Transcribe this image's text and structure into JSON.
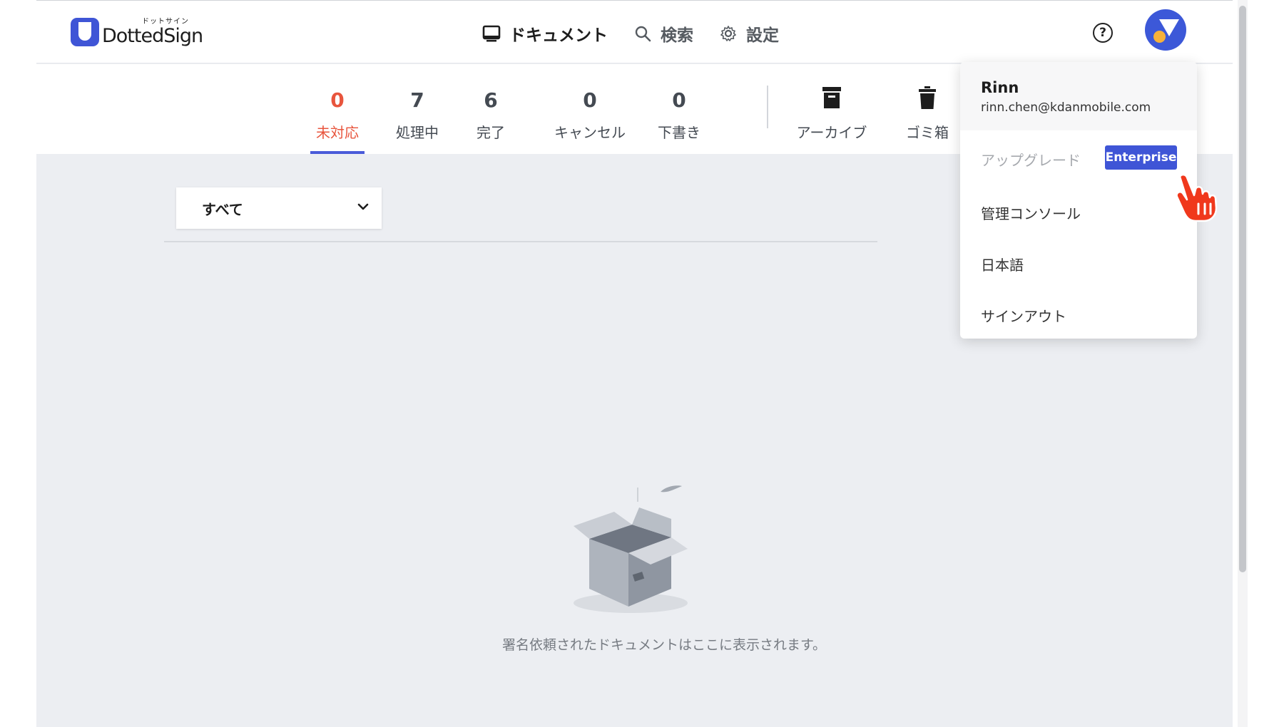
{
  "app": {
    "logo_kana": "ドットサイン",
    "logo_name": "DottedSign"
  },
  "nav": {
    "items": [
      {
        "label": "ドキュメント",
        "icon": "inbox-icon"
      },
      {
        "label": "検索",
        "icon": "search-icon"
      },
      {
        "label": "設定",
        "icon": "gear-icon"
      }
    ]
  },
  "header": {
    "help": "?",
    "avatar_icon": "avatar-icon"
  },
  "stats": [
    {
      "count": "0",
      "label": "未対応",
      "active": true
    },
    {
      "count": "7",
      "label": "処理中"
    },
    {
      "count": "6",
      "label": "完了"
    },
    {
      "count": "0",
      "label": "キャンセル"
    },
    {
      "count": "0",
      "label": "下書き"
    }
  ],
  "folders": [
    {
      "label": "アーカイブ",
      "icon": "archive-icon"
    },
    {
      "label": "ゴミ箱",
      "icon": "trash-icon"
    }
  ],
  "filter": {
    "selected": "すべて"
  },
  "empty_state": {
    "message": "署名依頼されたドキュメントはここに表示されます。"
  },
  "user_menu": {
    "name": "Rinn",
    "email": "rinn.chen@kdanmobile.com",
    "upgrade_label": "アップグレード",
    "plan_badge": "Enterprise",
    "items": [
      "管理コンソール",
      "日本語",
      "サインアウト"
    ]
  },
  "colors": {
    "accent": "#3f55d6",
    "active_tab": "#e8553d",
    "background": "#eceef2"
  }
}
